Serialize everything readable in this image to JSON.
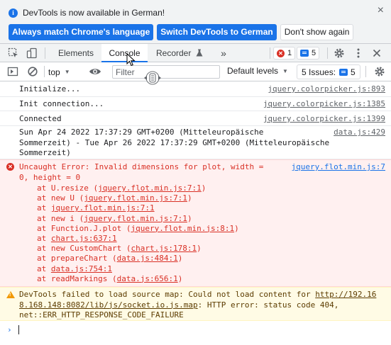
{
  "infobar": {
    "icon": "info-icon",
    "message": "DevTools is now available in German!",
    "close_label": "×",
    "buttons": {
      "match_language": "Always match Chrome's language",
      "switch_german": "Switch DevTools to German",
      "dont_show": "Don't show again"
    }
  },
  "tabbar": {
    "tabs": [
      "Elements",
      "Console",
      "Recorder"
    ],
    "active_tab": "Console",
    "more_label": "»",
    "error_count": "1",
    "message_count": "5"
  },
  "toolbar": {
    "context": "top",
    "filter_placeholder": "Filter",
    "levels_label": "Default levels",
    "issues_label": "5 Issues:",
    "issues_count": "5"
  },
  "console": {
    "logs": [
      {
        "text": "Initialize...",
        "source": "jquery.colorpicker.js:893"
      },
      {
        "text": "Init connection...",
        "source": "jquery.colorpicker.js:1385"
      },
      {
        "text": "Connected",
        "source": "jquery.colorpicker.js:1399"
      },
      {
        "text": "Sun Apr 24 2022 17:37:29 GMT+0200 (Mitteleuropäische\nSommerzeit) - Tue Apr 26 2022 17:37:29 GMT+0200 (Mitteleuropäische\nSommerzeit)",
        "source": "data.js:429"
      }
    ],
    "error": {
      "text": "Uncaught Error: Invalid dimensions for plot, width =\n0, height = 0",
      "source": "jquery.flot.min.js:7",
      "stack": [
        {
          "prefix": "at U.resize (",
          "link": "jquery.flot.min.js:7:1",
          "suffix": ")"
        },
        {
          "prefix": "at new U (",
          "link": "jquery.flot.min.js:7:1",
          "suffix": ")"
        },
        {
          "prefix": "at ",
          "link": "jquery.flot.min.js:7:1",
          "suffix": ""
        },
        {
          "prefix": "at new i (",
          "link": "jquery.flot.min.js:7:1",
          "suffix": ")"
        },
        {
          "prefix": "at Function.J.plot (",
          "link": "jquery.flot.min.js:8:1",
          "suffix": ")"
        },
        {
          "prefix": "at ",
          "link": "chart.js:637:1",
          "suffix": ""
        },
        {
          "prefix": "at new CustomChart (",
          "link": "chart.js:178:1",
          "suffix": ")"
        },
        {
          "prefix": "at prepareChart (",
          "link": "data.js:484:1",
          "suffix": ")"
        },
        {
          "prefix": "at ",
          "link": "data.js:754:1",
          "suffix": ""
        },
        {
          "prefix": "at readMarkings (",
          "link": "data.js:656:1",
          "suffix": ")"
        }
      ]
    },
    "warning": {
      "line1_prefix": "DevTools failed to load source map: Could not load content for ",
      "url_part1": "http://192.16",
      "url_part2": "8.168.148:8082/lib/js/socket.io.js.map",
      "line2_suffix": ": HTTP error: status code 404,",
      "line3": "net::ERR_HTTP_RESPONSE_CODE_FAILURE"
    },
    "prompt_symbol": "›"
  },
  "colors": {
    "accent": "#1a73e8",
    "error": "#d93025",
    "error_bg": "#fff0f0",
    "warning": "#f29900",
    "warning_bg": "#fffbe5"
  }
}
